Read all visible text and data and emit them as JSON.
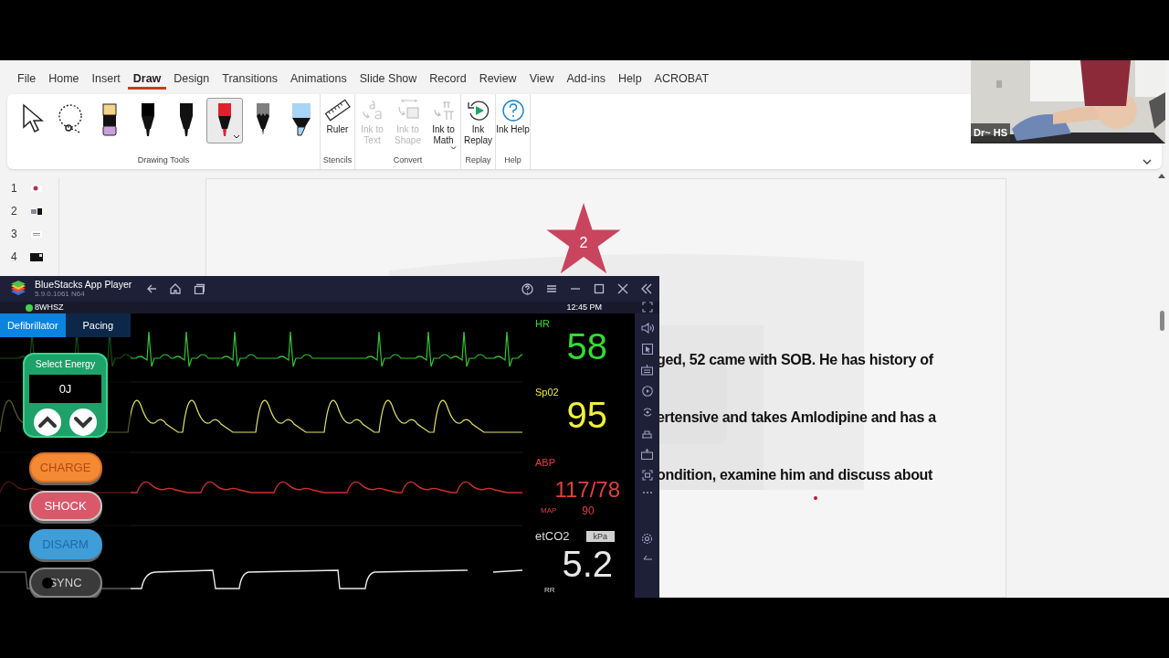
{
  "ribbon_tabs": [
    {
      "label": "File",
      "selected": false
    },
    {
      "label": "Home",
      "selected": false
    },
    {
      "label": "Insert",
      "selected": false
    },
    {
      "label": "Draw",
      "selected": true
    },
    {
      "label": "Design",
      "selected": false
    },
    {
      "label": "Transitions",
      "selected": false
    },
    {
      "label": "Animations",
      "selected": false
    },
    {
      "label": "Slide Show",
      "selected": false
    },
    {
      "label": "Record",
      "selected": false
    },
    {
      "label": "Review",
      "selected": false
    },
    {
      "label": "View",
      "selected": false
    },
    {
      "label": "Add-ins",
      "selected": false
    },
    {
      "label": "Help",
      "selected": false
    },
    {
      "label": "ACROBAT",
      "selected": false
    }
  ],
  "drawing_tools": {
    "label": "Drawing Tools",
    "tools": [
      {
        "kind": "pointer",
        "selected": false
      },
      {
        "kind": "lasso",
        "selected": false
      },
      {
        "kind": "eraser",
        "selected": false
      },
      {
        "kind": "pen",
        "color": "#000000",
        "selected": false
      },
      {
        "kind": "pen",
        "color": "#111111",
        "selected": false
      },
      {
        "kind": "pen",
        "color": "#e0202a",
        "selected": true
      },
      {
        "kind": "pencil",
        "color": "#808080",
        "selected": false
      },
      {
        "kind": "highlighter",
        "color": "#a8d4f5",
        "selected": false
      }
    ]
  },
  "ribbon_groups": [
    {
      "label": "Stencils",
      "buttons": [
        {
          "kind": "ruler",
          "label": "Ruler",
          "disabled": false
        }
      ]
    },
    {
      "label": "Convert",
      "buttons": [
        {
          "kind": "ink-to-text",
          "label": "Ink to Text",
          "disabled": true
        },
        {
          "kind": "ink-to-shape",
          "label": "Ink to Shape",
          "disabled": true
        },
        {
          "kind": "ink-to-math",
          "label": "Ink to Math",
          "disabled": false
        }
      ]
    },
    {
      "label": "Replay",
      "buttons": [
        {
          "kind": "replay",
          "label": "Ink Replay",
          "disabled": false
        }
      ]
    },
    {
      "label": "Help",
      "buttons": [
        {
          "kind": "help",
          "label": "Ink Help",
          "disabled": false
        }
      ]
    }
  ],
  "webcam": {
    "name": "Dr~ HS"
  },
  "slide_numbers": [
    "1",
    "2",
    "3",
    "4"
  ],
  "slide": {
    "star_badge": "2",
    "text_lines": [
      "ged, 52 came with SOB. He has history of",
      "ertensive and takes Amlodipine and has a",
      "ondition, examine him and discuss about"
    ]
  },
  "bluestacks": {
    "title": "BlueStacks App Player",
    "version": "5.9.0.1061 N64",
    "instance": "8WHSZ",
    "time": "12:45 PM"
  },
  "monitor": {
    "mode_tabs": [
      {
        "label": "Defibrillator",
        "selected": true
      },
      {
        "label": "Pacing",
        "selected": false
      }
    ],
    "energy": {
      "label": "Select Energy",
      "value": "0J"
    },
    "actions": [
      {
        "kind": "charge",
        "label": "CHARGE"
      },
      {
        "kind": "shock",
        "label": "SHOCK"
      },
      {
        "kind": "disarm",
        "label": "DISARM"
      },
      {
        "kind": "sync",
        "label": "SYNC"
      }
    ],
    "vitals": [
      {
        "kind": "hr",
        "label": "HR",
        "value": "58",
        "color": "#33dd33"
      },
      {
        "kind": "spo2",
        "label": "Sp02",
        "value": "95",
        "color": "#f0f03c"
      },
      {
        "kind": "abp",
        "label": "ABP",
        "value": "117/78",
        "color": "#e04040",
        "map_label": "MAP",
        "map_value": "90"
      },
      {
        "kind": "etco2",
        "label": "etCO2",
        "value": "5.2",
        "color": "#e8e8e8",
        "unit": "kPa",
        "sub_label": "RR"
      }
    ]
  }
}
